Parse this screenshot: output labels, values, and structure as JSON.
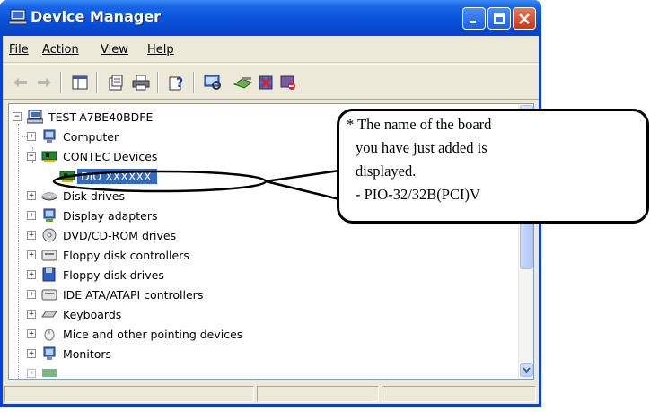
{
  "window": {
    "title": "Device Manager",
    "title_icon": "computer-icon"
  },
  "menu": [
    {
      "label": "File"
    },
    {
      "label": "Action"
    },
    {
      "label": "View"
    },
    {
      "label": "Help"
    }
  ],
  "toolbar": {
    "items": [
      "back-arrow-icon",
      "forward-arrow-icon",
      "show-hide-console-tree-icon",
      "properties-icon",
      "print-icon",
      "help-icon",
      "scan-hardware-icon",
      "update-driver-icon",
      "uninstall-icon",
      "disable-icon"
    ]
  },
  "tree": {
    "root": "TEST-A7BE40BDFE",
    "nodes": [
      {
        "label": "Computer",
        "icon": "computer-icon",
        "expander": "+"
      },
      {
        "label": "CONTEC Devices",
        "icon": "board-icon",
        "expander": "−"
      },
      {
        "label": "DIO XXXXXX",
        "icon": "board-icon",
        "selected": true
      },
      {
        "label": "Disk drives",
        "icon": "disk-drive-icon",
        "expander": "+"
      },
      {
        "label": "Display adapters",
        "icon": "display-adapter-icon",
        "expander": "+"
      },
      {
        "label": "DVD/CD-ROM drives",
        "icon": "cdrom-icon",
        "expander": "+"
      },
      {
        "label": "Floppy disk controllers",
        "icon": "controller-icon",
        "expander": "+"
      },
      {
        "label": "Floppy disk drives",
        "icon": "floppy-icon",
        "expander": "+"
      },
      {
        "label": "IDE ATA/ATAPI controllers",
        "icon": "controller-icon",
        "expander": "+"
      },
      {
        "label": "Keyboards",
        "icon": "keyboard-icon",
        "expander": "+"
      },
      {
        "label": "Mice and other pointing devices",
        "icon": "mouse-icon",
        "expander": "+"
      },
      {
        "label": "Monitors",
        "icon": "monitor-icon",
        "expander": "+"
      }
    ]
  },
  "callout": {
    "lines": [
      "* The name of the board",
      "you have just added is",
      "displayed.",
      "- PIO-32/32B(PCI)V"
    ]
  },
  "colors": {
    "titlebar": "#0a55dd",
    "selection": "#316ac5",
    "window_bg": "#ece9d8"
  }
}
